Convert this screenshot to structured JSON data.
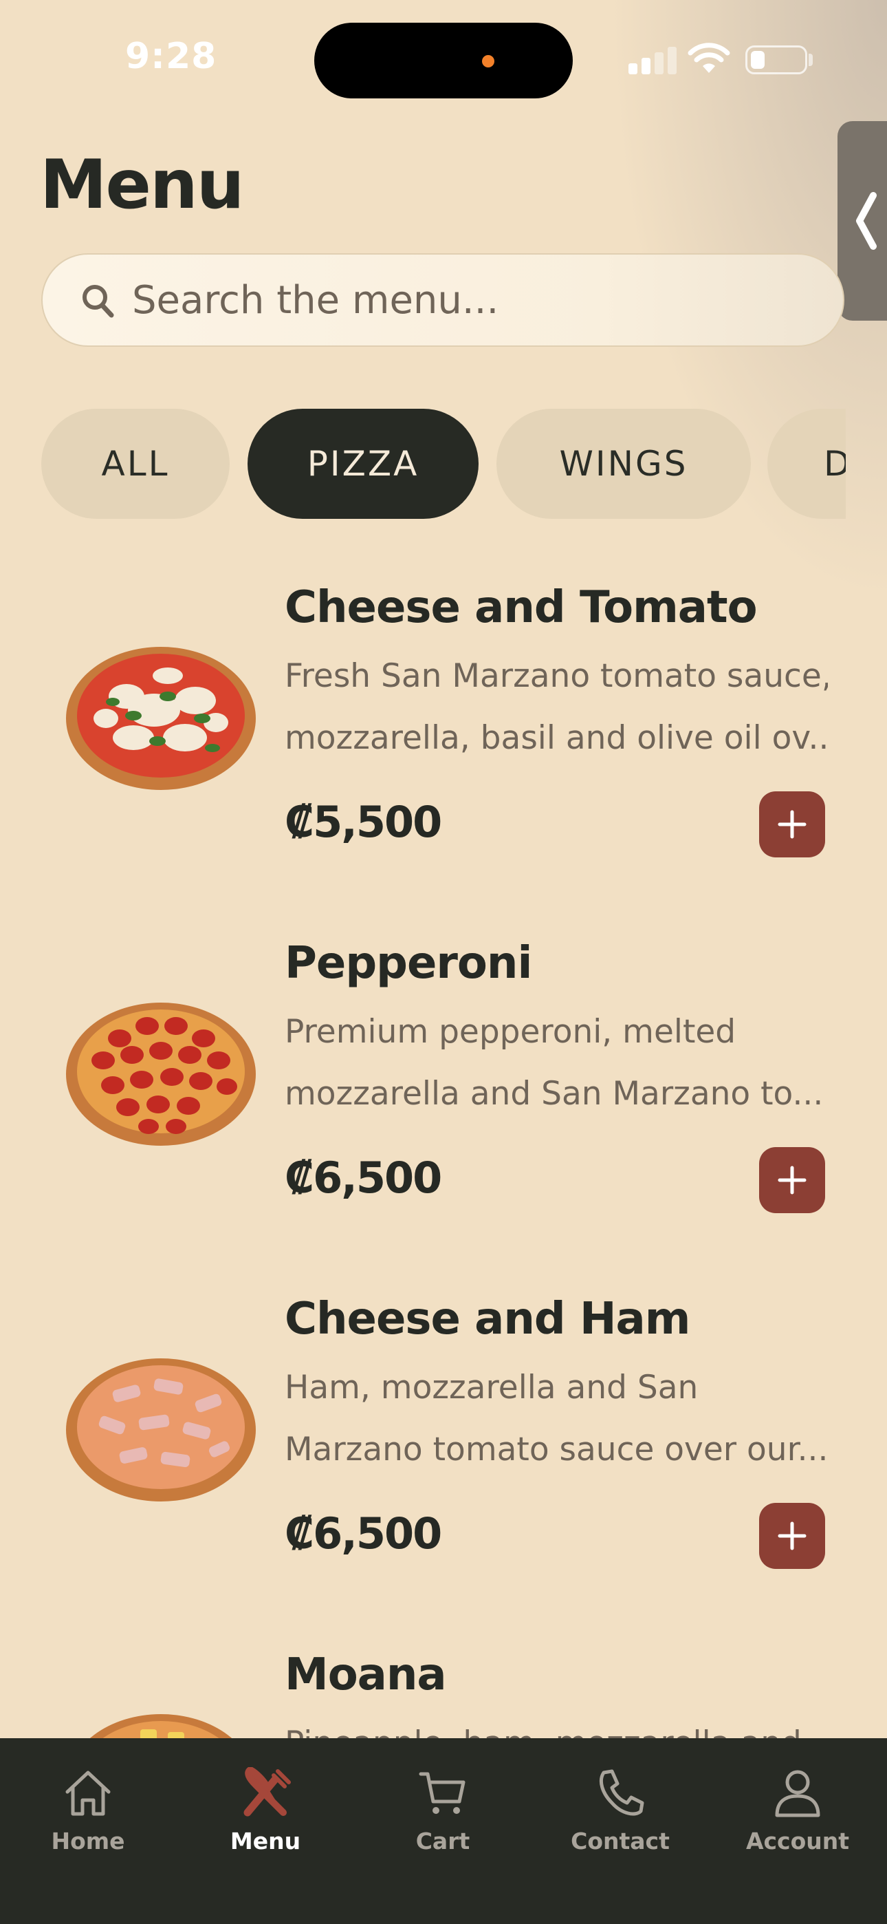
{
  "status_bar": {
    "time": "9:28"
  },
  "page": {
    "title": "Menu"
  },
  "search": {
    "placeholder": "Search the menu..."
  },
  "categories": [
    {
      "label": "ALL",
      "active": false
    },
    {
      "label": "PIZZA",
      "active": true
    },
    {
      "label": "WINGS",
      "active": false
    },
    {
      "label": "D",
      "active": false
    }
  ],
  "menu_items": [
    {
      "name": "Cheese and Tomato",
      "desc_line1": "Fresh San Marzano tomato sauce,",
      "desc_line2": "mozzarella, basil and olive oil ov...",
      "price": "₡5,500",
      "image": "margherita-pizza"
    },
    {
      "name": "Pepperoni",
      "desc_line1": "Premium pepperoni, melted",
      "desc_line2": "mozzarella and San Marzano to...",
      "price": "₡6,500",
      "image": "pepperoni-pizza"
    },
    {
      "name": "Cheese and Ham",
      "desc_line1": "Ham, mozzarella and San",
      "desc_line2": "Marzano tomato sauce over our...",
      "price": "₡6,500",
      "image": "ham-pizza"
    },
    {
      "name": "Moana",
      "desc_line1": "Pineapple, ham, mozzarella and",
      "image": "pineapple-pizza"
    }
  ],
  "bottom_nav": [
    {
      "label": "Home",
      "icon": "home-icon",
      "active": false
    },
    {
      "label": "Menu",
      "icon": "fork-knife-icon",
      "active": true
    },
    {
      "label": "Cart",
      "icon": "cart-icon",
      "active": false
    },
    {
      "label": "Contact",
      "icon": "phone-icon",
      "active": false
    },
    {
      "label": "Account",
      "icon": "user-icon",
      "active": false
    }
  ],
  "colors": {
    "background": "#f2e0c4",
    "dark": "#272a24",
    "accent": "#8c3f34",
    "chip": "#e4d4b8",
    "muted_text": "#6f6458"
  }
}
